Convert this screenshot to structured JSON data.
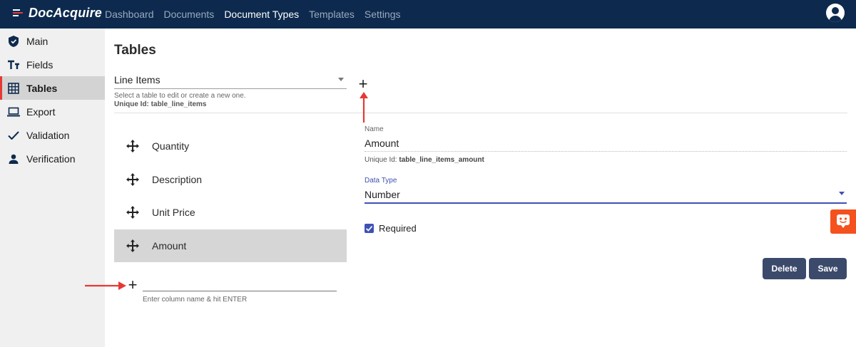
{
  "brand": {
    "name": "DocAcquire"
  },
  "nav": {
    "items": [
      "Dashboard",
      "Documents",
      "Document Types",
      "Templates",
      "Settings"
    ],
    "active": "Document Types"
  },
  "sidebar": {
    "items": [
      {
        "label": "Main",
        "icon": "shield-icon"
      },
      {
        "label": "Fields",
        "icon": "text-fields-icon"
      },
      {
        "label": "Tables",
        "icon": "grid-icon"
      },
      {
        "label": "Export",
        "icon": "laptop-icon"
      },
      {
        "label": "Validation",
        "icon": "check-icon"
      },
      {
        "label": "Verification",
        "icon": "person-icon"
      }
    ],
    "active": "Tables"
  },
  "page": {
    "title": "Tables"
  },
  "table_select": {
    "value": "Line Items",
    "helper": "Select a table to edit or create a new one.",
    "unique_id_prefix": "Unique Id:",
    "unique_id": "table_line_items",
    "add_symbol": "+"
  },
  "columns": {
    "items": [
      "Quantity",
      "Description",
      "Unit Price",
      "Amount"
    ],
    "selected": "Amount",
    "add_symbol": "+",
    "input_value": "",
    "input_helper": "Enter column name & hit ENTER"
  },
  "field": {
    "name_label": "Name",
    "name_value": "Amount",
    "unique_id_prefix": "Unique Id:",
    "unique_id": "table_line_items_amount",
    "data_type_label": "Data Type",
    "data_type_value": "Number",
    "required_label": "Required",
    "required": true
  },
  "actions": {
    "delete_label": "Delete",
    "save_label": "Save"
  },
  "colors": {
    "topbar": "#0d2a4e",
    "accent": "#3f51b5",
    "button": "#3b4a6b",
    "sidebar_active_border": "#e53935",
    "annotation_arrow": "#e53935",
    "help_widget": "#f4511e"
  }
}
